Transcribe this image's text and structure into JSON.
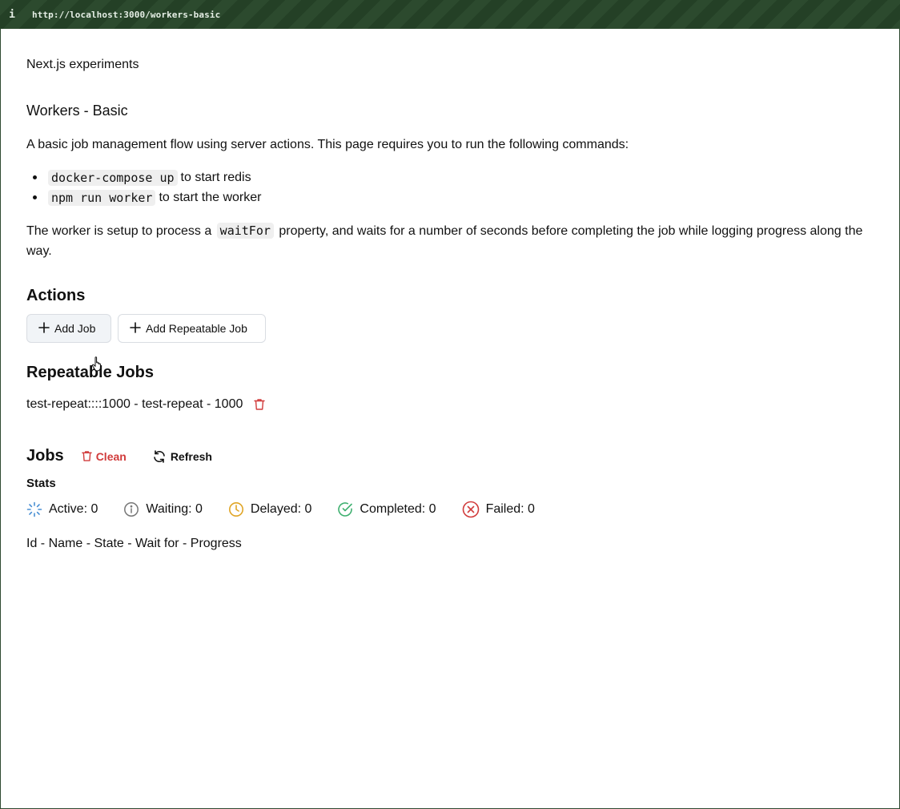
{
  "browser": {
    "info_label": "i",
    "url": "http://localhost:3000/workers-basic"
  },
  "site": {
    "title": "Next.js experiments"
  },
  "page": {
    "heading": "Workers - Basic",
    "intro": "A basic job management flow using server actions. This page requires you to run the following commands:",
    "commands": [
      {
        "code": "docker-compose up",
        "text": "to start redis"
      },
      {
        "code": "npm run worker",
        "text": "to start the worker"
      }
    ],
    "worker_desc_pre": "The worker is setup to process a",
    "worker_desc_code": "waitFor",
    "worker_desc_post": "property, and waits for a number of seconds before completing the job while logging progress along the way."
  },
  "actions": {
    "heading": "Actions",
    "add_job_label": "Add Job",
    "add_repeatable_label": "Add Repeatable Job",
    "plus_icon": "plus-icon"
  },
  "repeatable": {
    "heading": "Repeatable Jobs",
    "items": [
      {
        "label": "test-repeat::::1000 - test-repeat - 1000",
        "icon": "trash-icon"
      }
    ]
  },
  "jobs": {
    "heading": "Jobs",
    "clean_label": "Clean",
    "refresh_label": "Refresh",
    "stats_heading": "Stats",
    "stats": {
      "active": "Active: 0",
      "waiting": "Waiting: 0",
      "delayed": "Delayed: 0",
      "completed": "Completed: 0",
      "failed": "Failed: 0"
    },
    "columns_header": "Id - Name - State - Wait for - Progress"
  },
  "colors": {
    "danger": "#d13b3b",
    "active": "#4a8fd4",
    "waiting": "#777777",
    "delayed": "#e0a526",
    "completed": "#3fb070",
    "failed": "#d13b3b",
    "urlbar": "#2c4a2e"
  }
}
